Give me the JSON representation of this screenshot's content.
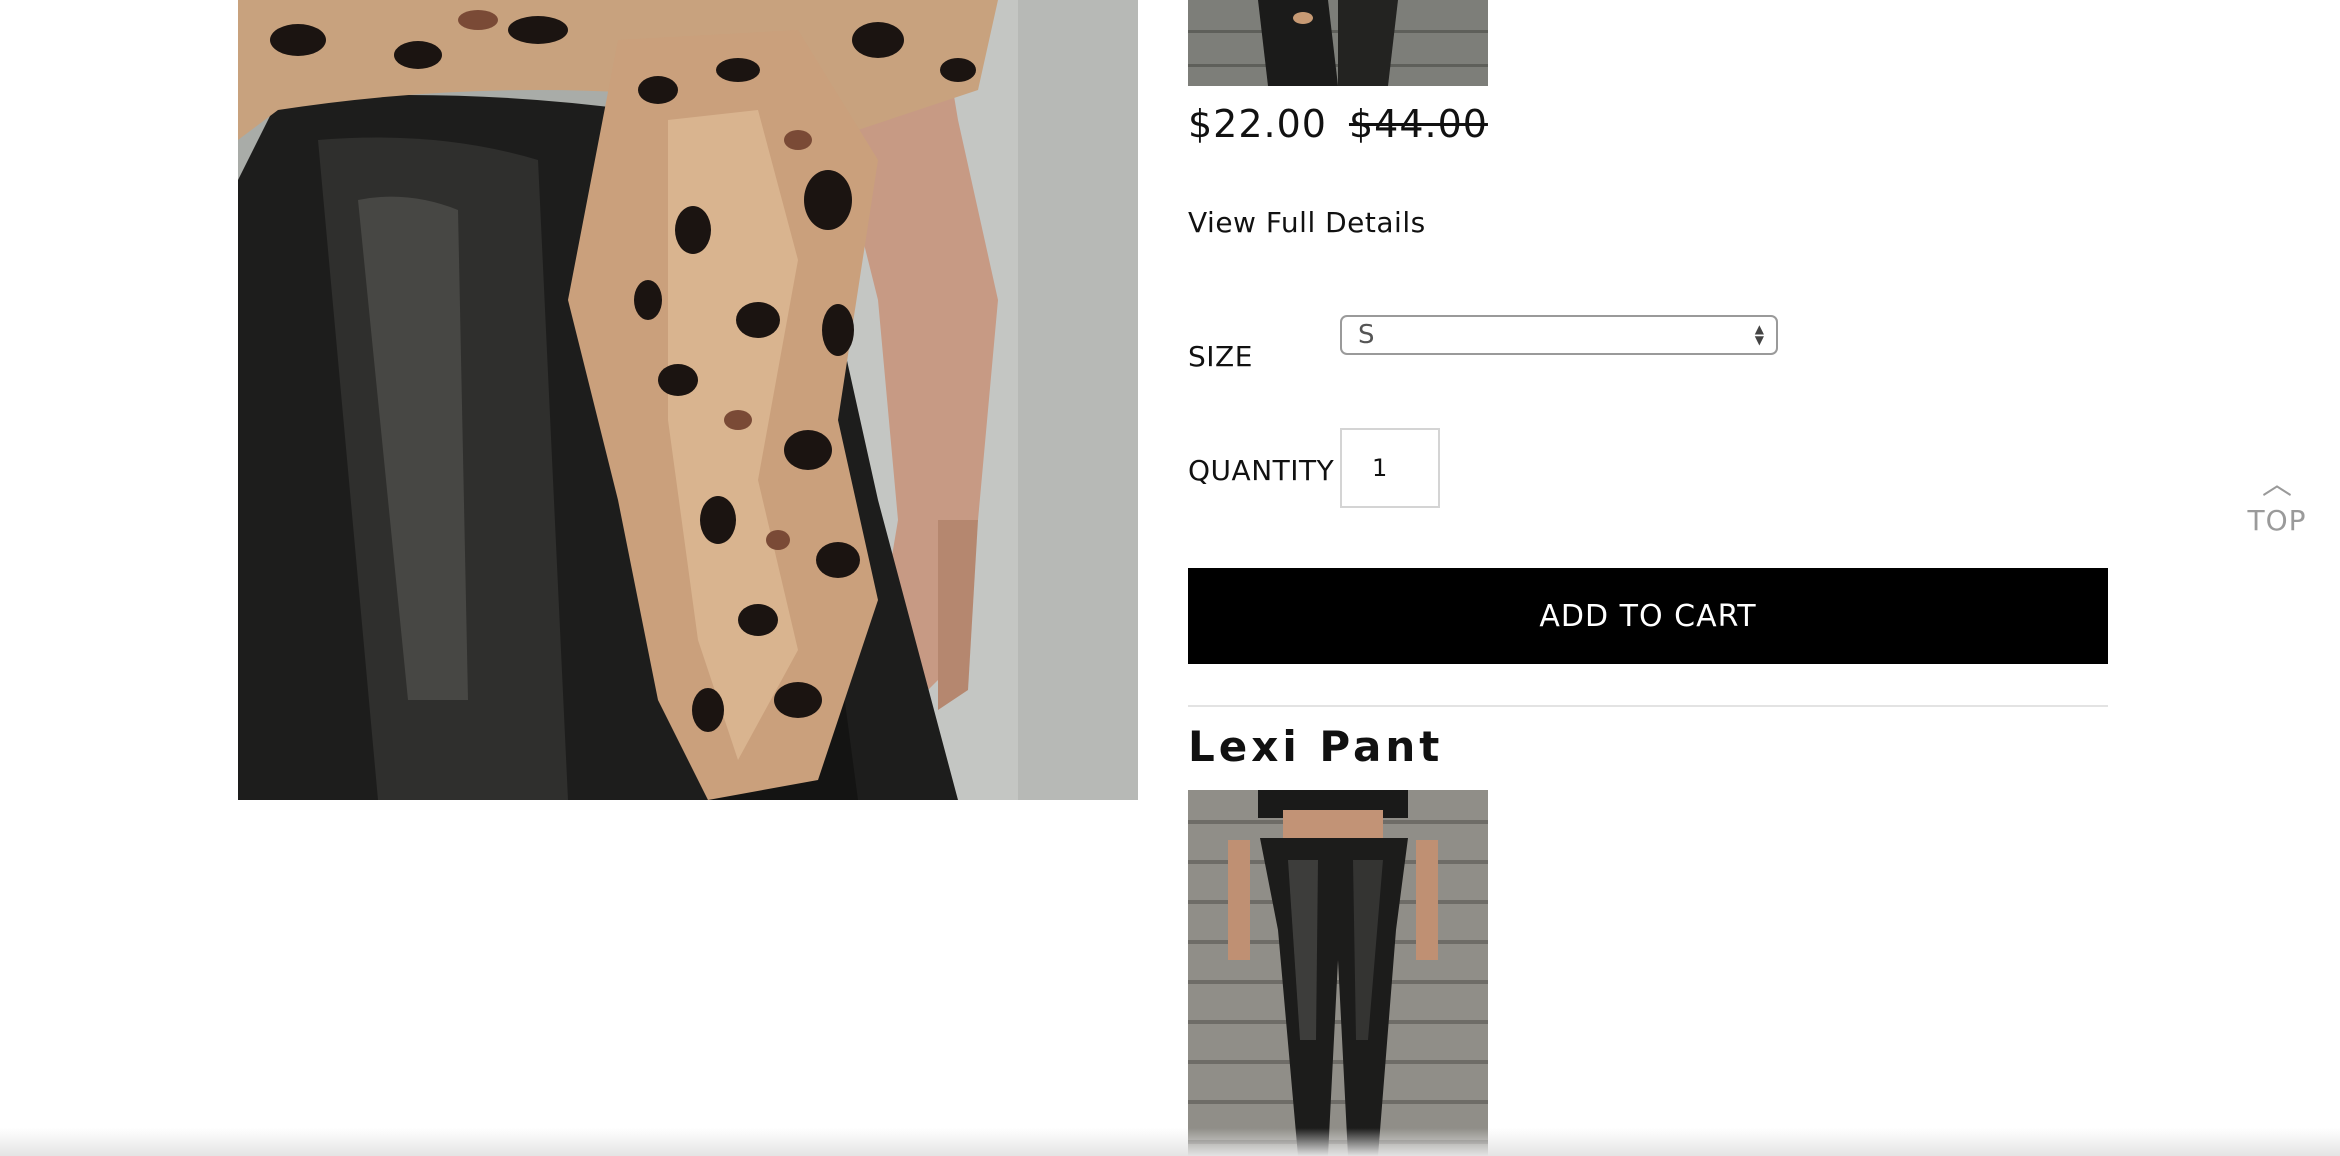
{
  "product": {
    "price_sale": "$22.00",
    "price_original": "$44.00",
    "details_link": "View Full Details",
    "size_label": "SIZE",
    "size_selected": "S",
    "quantity_label": "QUANTITY",
    "quantity_value": "1",
    "add_to_cart": "ADD TO CART"
  },
  "next_product": {
    "title": "Lexi Pant"
  },
  "back_to_top": {
    "label": "TOP",
    "icon": "chevron-up-icon"
  },
  "colors": {
    "button_bg": "#000000",
    "button_text": "#ffffff",
    "top_link": "#9a9a9a"
  }
}
